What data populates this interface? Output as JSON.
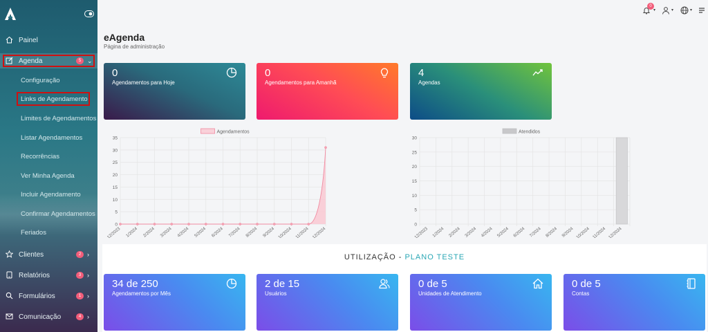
{
  "sidebar": {
    "items": [
      {
        "label": "Painel",
        "icon": "home-icon"
      },
      {
        "label": "Agenda",
        "icon": "edit-icon",
        "badge": "5"
      },
      {
        "label": "Clientes",
        "icon": "star-icon",
        "badge": "2"
      },
      {
        "label": "Relatórios",
        "icon": "tablet-icon",
        "badge": "3"
      },
      {
        "label": "Formulários",
        "icon": "search-icon",
        "badge": "1"
      },
      {
        "label": "Comunicação",
        "icon": "mail-icon",
        "badge": "4"
      }
    ],
    "subitems": [
      "Configuração",
      "Links de Agendamento",
      "Limites de Agendamentos",
      "Listar Agendamentos",
      "Recorrências",
      "Ver Minha Agenda",
      "Incluir Agendamento",
      "Confirmar Agendamentos",
      "Feriados"
    ]
  },
  "header": {
    "notification_count": "0",
    "title": "eAgenda",
    "subtitle": "Página de administração"
  },
  "stats": [
    {
      "value": "0",
      "label": "Agendamentos para Hoje",
      "icon": "pie-chart-icon"
    },
    {
      "value": "0",
      "label": "Agendamentos para Amanhã",
      "icon": "lightbulb-icon"
    },
    {
      "value": "4",
      "label": "Agendas",
      "icon": "trend-line-icon"
    }
  ],
  "usage": {
    "title_prefix": "UTILIZAÇÃO - ",
    "plan": "PLANO TESTE",
    "cards": [
      {
        "value": "34 de 250",
        "label": "Agendamentos por Mês",
        "icon": "pie-chart-icon"
      },
      {
        "value": "2 de 15",
        "label": "Usuários",
        "icon": "users-icon"
      },
      {
        "value": "0 de 5",
        "label": "Unidades de Atendimento",
        "icon": "home-icon"
      },
      {
        "value": "0 de 5",
        "label": "Contas",
        "icon": "notebook-icon"
      }
    ]
  },
  "chart_data": [
    {
      "type": "area",
      "series": [
        {
          "name": "Agendamentos",
          "values": [
            0,
            0,
            0,
            0,
            0,
            0,
            0,
            0,
            0,
            0,
            0,
            0,
            31
          ]
        }
      ],
      "x": [
        "12/2023",
        "1/2024",
        "2/2024",
        "3/2024",
        "4/2024",
        "5/2024",
        "6/2024",
        "7/2024",
        "8/2024",
        "9/2024",
        "10/2024",
        "11/2024",
        "12/2024"
      ],
      "yticks": [
        "0",
        "5",
        "10",
        "15",
        "20",
        "25",
        "30",
        "35"
      ],
      "ylim": [
        0,
        35
      ],
      "colors": {
        "fill": "#f9c8d2",
        "line": "#f08aa0",
        "legend_fill": "#f9d1d9"
      },
      "grid": true,
      "legend_position": "top"
    },
    {
      "type": "bar",
      "series": [
        {
          "name": "Atendidos",
          "values": [
            0,
            0,
            0,
            0,
            0,
            0,
            0,
            0,
            0,
            0,
            0,
            0,
            30
          ]
        }
      ],
      "x": [
        "12/2023",
        "1/2024",
        "2/2024",
        "3/2024",
        "4/2024",
        "5/2024",
        "6/2024",
        "7/2024",
        "8/2024",
        "9/2024",
        "10/2024",
        "11/2024",
        "12/2024"
      ],
      "yticks": [
        "0",
        "5",
        "10",
        "15",
        "20",
        "25",
        "30"
      ],
      "ylim": [
        0,
        30
      ],
      "colors": {
        "fill": "#d8d8da",
        "line": "#c0c0c2",
        "legend_fill": "#c8c8ca"
      },
      "grid": true,
      "legend_position": "top"
    }
  ]
}
